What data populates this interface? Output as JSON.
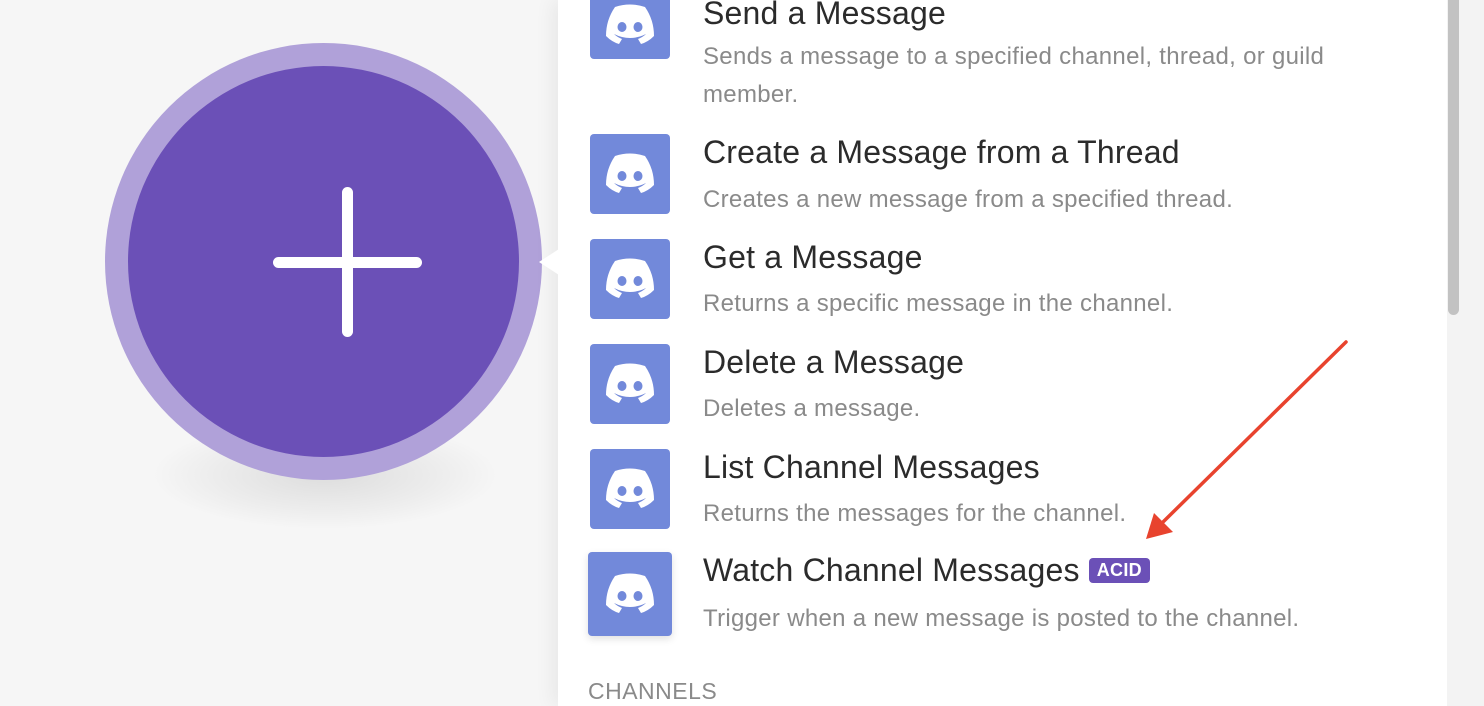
{
  "canvas": {
    "add_module_icon": "plus-icon"
  },
  "module_list": {
    "items": [
      {
        "icon": "discord-icon",
        "title": "Send a Message",
        "description": "Sends a message to a specified channel, thread, or guild member."
      },
      {
        "icon": "discord-icon",
        "title": "Create a Message from a Thread",
        "description": "Creates a new message from a specified thread."
      },
      {
        "icon": "discord-icon",
        "title": "Get a Message",
        "description": "Returns a specific message in the channel."
      },
      {
        "icon": "discord-icon",
        "title": "Delete a Message",
        "description": "Deletes a message."
      },
      {
        "icon": "discord-icon",
        "title": "List Channel Messages",
        "description": "Returns the messages for the channel."
      },
      {
        "icon": "discord-icon",
        "title": "Watch Channel Messages",
        "badge": "ACID",
        "description": "Trigger when a new message is posted to the channel."
      }
    ],
    "next_section_heading": "CHANNELS"
  },
  "colors": {
    "add_button": "#6b50b7",
    "add_button_ring": "#b0a1d9",
    "discord_icon_bg": "#7289da",
    "badge_bg": "#6b50b7",
    "annotation_arrow": "#e8432e"
  }
}
